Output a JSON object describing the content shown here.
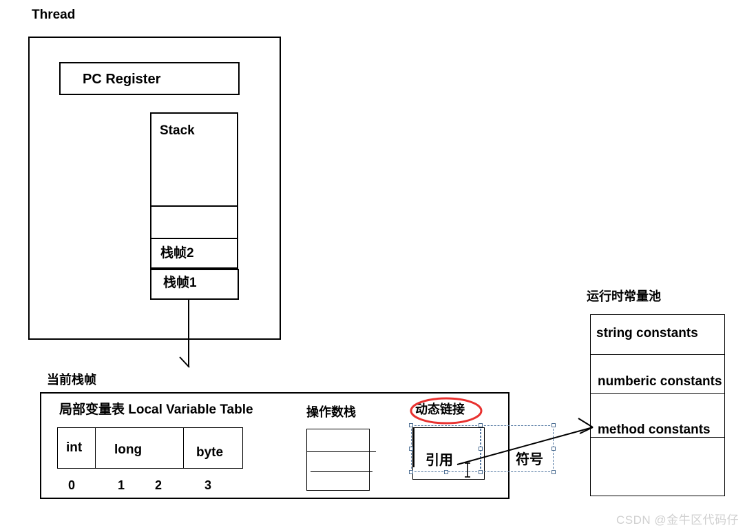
{
  "diagram": {
    "title_thread": "Thread",
    "title_current_frame": "当前栈帧",
    "title_runtime_constant_pool": "运行时常量池"
  },
  "thread": {
    "pc_register": "PC Register",
    "stack": {
      "label": "Stack",
      "frames": [
        {
          "label": "栈帧2"
        },
        {
          "label": "栈帧1"
        }
      ]
    }
  },
  "current_frame": {
    "local_variable_table": {
      "title": "局部变量表 Local Variable Table",
      "cells": [
        {
          "type": "int"
        },
        {
          "type": "long"
        },
        {
          "type": "byte"
        }
      ],
      "slot_indices": [
        "0",
        "1",
        "2",
        "3"
      ]
    },
    "operand_stack": {
      "title": "操作数栈"
    },
    "dynamic_linking": {
      "title": "动态链接",
      "highlight_color": "#e8312f",
      "reference_box": "引用",
      "symbol_label": "符号"
    }
  },
  "runtime_constant_pool": {
    "rows": [
      "string constants",
      "numberic constants",
      "method constants"
    ]
  },
  "watermark": {
    "text": "CSDN @金牛区代码仔"
  }
}
